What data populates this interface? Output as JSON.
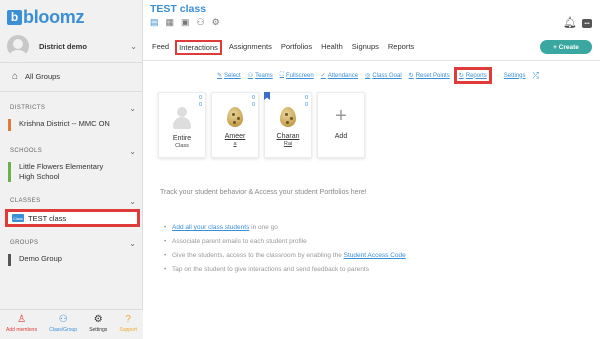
{
  "brand": {
    "logo_letter": "b",
    "logo_text": "bloomz"
  },
  "user": {
    "name": "District demo"
  },
  "sidebar": {
    "all_groups": "All Groups",
    "districts_header": "DISTRICTS",
    "district_item": "Krishna District -- MMC ON",
    "schools_header": "SCHOOLS",
    "school_item": "Little Flowers Elementary High School",
    "classes_header": "CLASSES",
    "class_item": "TEST class",
    "class_badge": "Class",
    "groups_header": "GROUPS",
    "group_item": "Demo Group",
    "bottom": [
      "Add members",
      "Class/Group",
      "Settings",
      "Support"
    ]
  },
  "header": {
    "title": "TEST class",
    "chat_badge": "•••",
    "create_label": "+ Create"
  },
  "tabs": [
    "Feed",
    "Interactions",
    "Assignments",
    "Portfolios",
    "Health",
    "Signups",
    "Reports"
  ],
  "toolbar": [
    "Select",
    "Teams",
    "Fullscreen",
    "Attendance",
    "Class Goal",
    "Reset Points",
    "Reports",
    "Settings"
  ],
  "cards": [
    {
      "name": "Entire",
      "sub": "Class",
      "count_top": "0",
      "count_bottom": "0"
    },
    {
      "name": "Ameer",
      "sub": "a",
      "count_top": "0",
      "count_bottom": "0"
    },
    {
      "name": "Charan",
      "sub": "Rai",
      "count_top": "0",
      "count_bottom": "0"
    },
    {
      "name": "Add"
    }
  ],
  "info": {
    "text": "Track your student behavior & Access your student Portfolios here!",
    "bullet1_link": "Add all your class students",
    "bullet1_rest": " in one go",
    "bullet2": "Associate parent emails to each student profile",
    "bullet3_pre": "Give the students, access to the classroom by enabling the ",
    "bullet3_link": "Student Access Code",
    "bullet4": "Tap on the student to give interactions and send feedback to parents"
  },
  "colors": {
    "brand": "#3b8fd6",
    "highlight": "#e03b3b",
    "create_button": "#3aa7a1"
  }
}
